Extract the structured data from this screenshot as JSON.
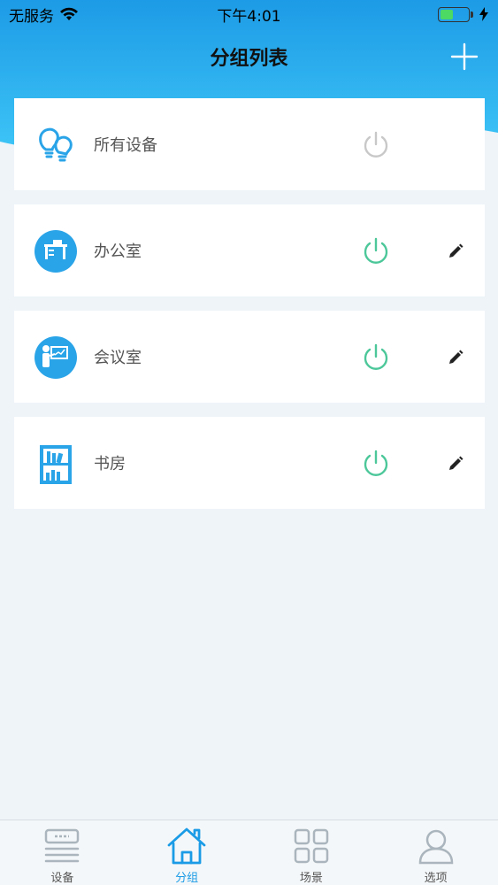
{
  "status_bar": {
    "carrier": "无服务",
    "time": "下午4:01"
  },
  "header": {
    "title": "分组列表",
    "add_icon": "plus-icon"
  },
  "colors": {
    "header_gradient_top": "#1d9be6",
    "header_gradient_bottom": "#35c3f5",
    "icon_blue": "#2aa4e8",
    "power_on": "#4cc79a",
    "power_off": "#c8c8c8",
    "active_tab": "#1a9be6"
  },
  "groups": [
    {
      "label": "所有设备",
      "icon": "light-bulbs-icon",
      "power": "off",
      "editable": false
    },
    {
      "label": "办公室",
      "icon": "office-desk-icon",
      "power": "on",
      "editable": true
    },
    {
      "label": "会议室",
      "icon": "meeting-presenter-icon",
      "power": "on",
      "editable": true
    },
    {
      "label": "书房",
      "icon": "bookshelf-icon",
      "power": "on",
      "editable": true
    }
  ],
  "tabs": [
    {
      "label": "设备",
      "icon": "device-icon",
      "active": false
    },
    {
      "label": "分组",
      "icon": "home-icon",
      "active": true
    },
    {
      "label": "场景",
      "icon": "scene-grid-icon",
      "active": false
    },
    {
      "label": "选项",
      "icon": "user-icon",
      "active": false
    }
  ]
}
